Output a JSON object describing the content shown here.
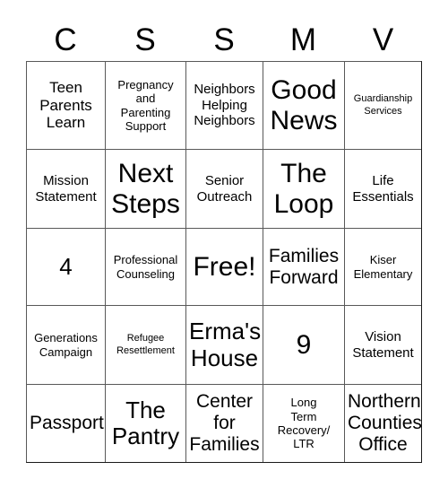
{
  "card": {
    "title_letters": [
      "C",
      "S",
      "S",
      "M",
      "V"
    ],
    "columns": 5,
    "rows": 5,
    "free_space_label": "Free!",
    "grid_line_color": "#595959",
    "outer_border_color": "#1a1a1a",
    "background_color": "#ffffff",
    "text_color": "#000000"
  },
  "cells": [
    {
      "text": "Teen\nParents\nLearn",
      "size": "lg"
    },
    {
      "text": "Pregnancy\nand\nParenting\nSupport",
      "size": "sm"
    },
    {
      "text": "Neighbors\nHelping\nNeighbors",
      "size": "md"
    },
    {
      "text": "Good\nNews",
      "size": "huge"
    },
    {
      "text": "Guardianship\nServices",
      "size": "xs"
    },
    {
      "text": "Mission\nStatement",
      "size": "md"
    },
    {
      "text": "Next\nSteps",
      "size": "huge"
    },
    {
      "text": "Senior\nOutreach",
      "size": "md"
    },
    {
      "text": "The\nLoop",
      "size": "huge"
    },
    {
      "text": "Life\nEssentials",
      "size": "md"
    },
    {
      "text": "4",
      "size": "xxl"
    },
    {
      "text": "Professional\nCounseling",
      "size": "sm"
    },
    {
      "text": "Free!",
      "size": "huge"
    },
    {
      "text": "Families\nForward",
      "size": "xl"
    },
    {
      "text": "Kiser\nElementary",
      "size": "sm"
    },
    {
      "text": "Generations\nCampaign",
      "size": "sm"
    },
    {
      "text": "Refugee\nResettlement",
      "size": "xs"
    },
    {
      "text": "Erma's\nHouse",
      "size": "xxl"
    },
    {
      "text": "9",
      "size": "huge"
    },
    {
      "text": "Vision\nStatement",
      "size": "md"
    },
    {
      "text": "Passport",
      "size": "xl"
    },
    {
      "text": "The\nPantry",
      "size": "xxl"
    },
    {
      "text": "Center\nfor\nFamilies",
      "size": "xl"
    },
    {
      "text": "Long\nTerm\nRecovery/\nLTR",
      "size": "sm"
    },
    {
      "text": "Northern\nCounties\nOffice",
      "size": "xl"
    }
  ]
}
